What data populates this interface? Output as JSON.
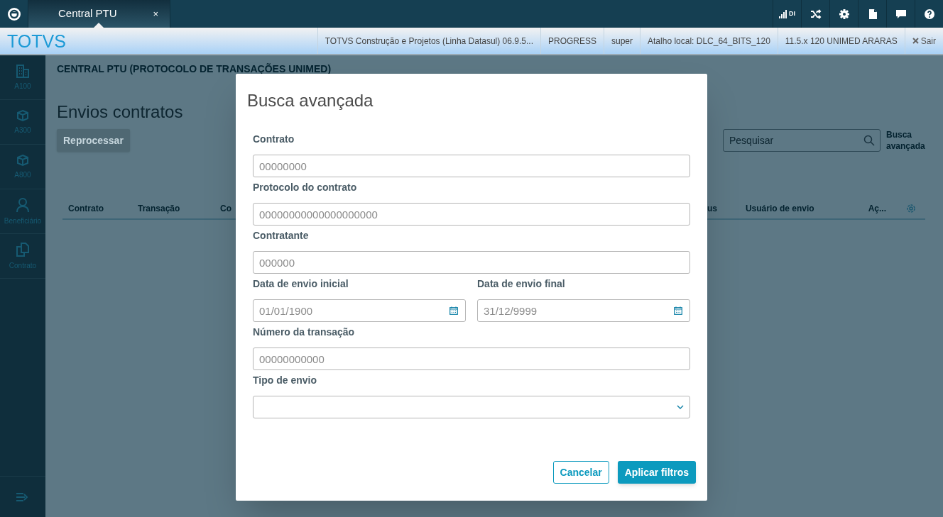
{
  "top_bar": {
    "tabs": [
      {
        "label": "Central PTU",
        "close": "×",
        "selected": true
      }
    ],
    "signal_label": "DI"
  },
  "header": {
    "brand": "TOTVS",
    "info": [
      "TOTVS Construção e Projetos (Linha Datasul) 06.9.5...",
      "PROGRESS",
      "super",
      "Atalho local: DLC_64_BITS_120",
      "11.5.x 120 UNIMED ARARAS"
    ],
    "logout": "Sair"
  },
  "sidebar": {
    "items": [
      {
        "kind": "building",
        "label": "A100"
      },
      {
        "kind": "cube",
        "label": "A300"
      },
      {
        "kind": "cube",
        "label": "A800"
      },
      {
        "kind": "person",
        "label": "Beneficiário"
      },
      {
        "kind": "copy",
        "label": "Contrato"
      }
    ]
  },
  "page": {
    "breadcrumb": "CENTRAL PTU (PROTOCOLO DE TRANSAÇÕES UNIMED)",
    "title": "Envios contratos",
    "reprocess_button": "Reprocessar",
    "search": {
      "placeholder": "Pesquisar"
    },
    "advanced_search_link": "Busca avançada",
    "table": {
      "columns": [
        "Contrato",
        "Transação",
        "Co",
        "us",
        "Usuário de envio",
        "Aç..."
      ]
    }
  },
  "dialog": {
    "title": "Busca avançada",
    "fields": [
      {
        "kind": "text",
        "label": "Contrato",
        "placeholder": "00000000"
      },
      {
        "kind": "text",
        "label": "Protocolo do contrato",
        "placeholder": "00000000000000000000"
      },
      {
        "kind": "text",
        "label": "Contratante",
        "placeholder": "000000"
      },
      {
        "kind": "date",
        "label": "Data de envio inicial",
        "placeholder": "01/01/1900"
      },
      {
        "kind": "date",
        "label": "Data de envio final",
        "placeholder": "31/12/9999"
      },
      {
        "kind": "text",
        "label": "Número da transação",
        "placeholder": "00000000000"
      },
      {
        "kind": "select",
        "label": "Tipo de envio"
      }
    ],
    "buttons": [
      {
        "kind": "secondary",
        "label": "Cancelar"
      },
      {
        "kind": "primary",
        "label": "Aplicar filtros"
      }
    ]
  }
}
